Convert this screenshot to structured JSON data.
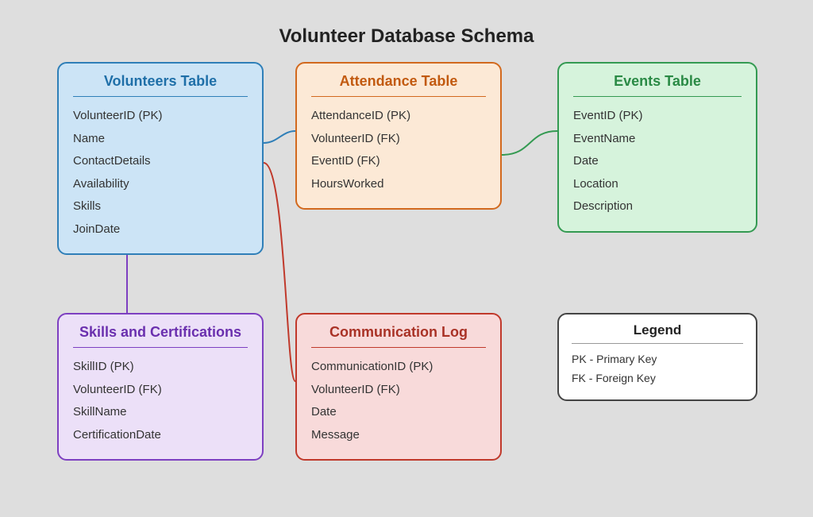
{
  "title": "Volunteer Database Schema",
  "tables": {
    "volunteers": {
      "title": "Volunteers Table",
      "fields": [
        "VolunteerID (PK)",
        "Name",
        "ContactDetails",
        "Availability",
        "Skills",
        "JoinDate"
      ]
    },
    "attendance": {
      "title": "Attendance Table",
      "fields": [
        "AttendanceID (PK)",
        "VolunteerID (FK)",
        "EventID (FK)",
        "HoursWorked"
      ]
    },
    "events": {
      "title": "Events Table",
      "fields": [
        "EventID (PK)",
        "EventName",
        "Date",
        "Location",
        "Description"
      ]
    },
    "skills": {
      "title": "Skills and Certifications",
      "fields": [
        "SkillID (PK)",
        "VolunteerID (FK)",
        "SkillName",
        "CertificationDate"
      ]
    },
    "comm": {
      "title": "Communication Log",
      "fields": [
        "CommunicationID (PK)",
        "VolunteerID (FK)",
        "Date",
        "Message"
      ]
    }
  },
  "legend": {
    "title": "Legend",
    "items": [
      "PK - Primary Key",
      "FK - Foreign Key"
    ]
  },
  "connectors": {
    "volunteers_attendance_color": "#2f7fb8",
    "attendance_events_color": "#349a52",
    "volunteers_skills_color": "#7d3fc1",
    "volunteers_comm_color": "#c0392b"
  }
}
